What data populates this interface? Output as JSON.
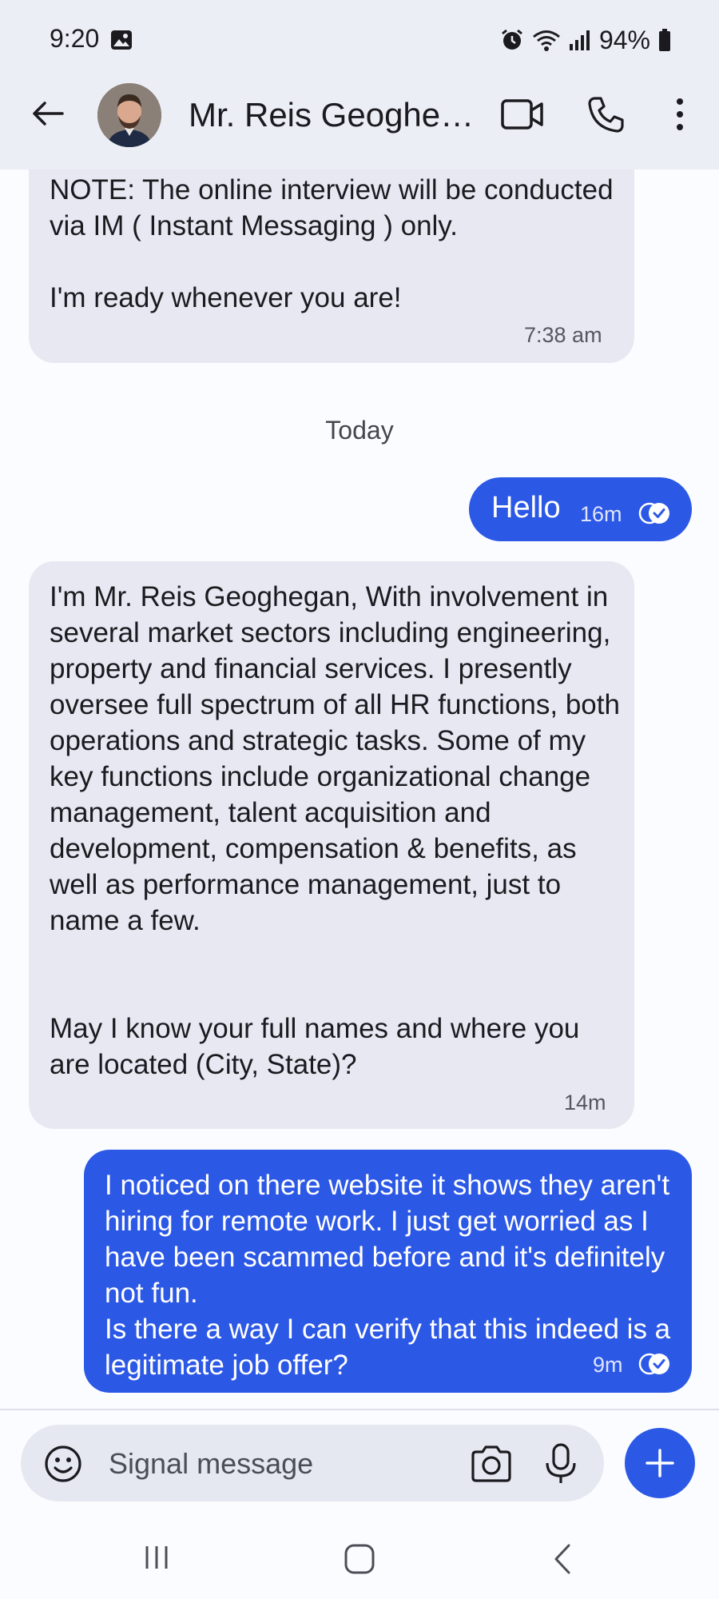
{
  "status_bar": {
    "time": "9:20",
    "battery": "94%",
    "icons": [
      "image-icon",
      "alarm-icon",
      "wifi-icon",
      "signal-icon",
      "battery-icon"
    ]
  },
  "header": {
    "contact_name": "Mr. Reis Geoghe…",
    "actions": [
      "back-icon",
      "video-call-icon",
      "call-icon",
      "more-menu-icon"
    ]
  },
  "conversation": {
    "messages": [
      {
        "direction": "incoming",
        "text": "NOTE: The online interview will be conducted via IM ( Instant Messaging ) only.\n\nI'm ready whenever you are!",
        "time": "7:38 am"
      },
      {
        "direction": "outgoing",
        "text": "Hello",
        "time": "16m",
        "status": "read"
      },
      {
        "direction": "incoming",
        "text": "I'm Mr. Reis Geoghegan, With involvement in several market sectors including engineering, property and financial services. I presently oversee full spectrum of all HR functions, both operations and strategic tasks. Some of my key functions include organizational change management, talent acquisition and development, compensation & benefits, as well as performance management, just to name a few.\n\n\nMay I know your full names and where you are located (City, State)?",
        "time": "14m"
      },
      {
        "direction": "outgoing",
        "text": "I noticed on there website it shows they aren't hiring for remote work. I just get worried as I have been scammed before and it's definitely not fun.\nIs there a way I can verify that this indeed is a legitimate job offer?",
        "time": "9m",
        "status": "read"
      }
    ],
    "date_divider": "Today"
  },
  "composer": {
    "placeholder": "Signal message",
    "value": ""
  },
  "colors": {
    "accent": "#2c58e6",
    "incoming_bubble": "#e7e8f2",
    "header_bg": "#eceef6"
  }
}
